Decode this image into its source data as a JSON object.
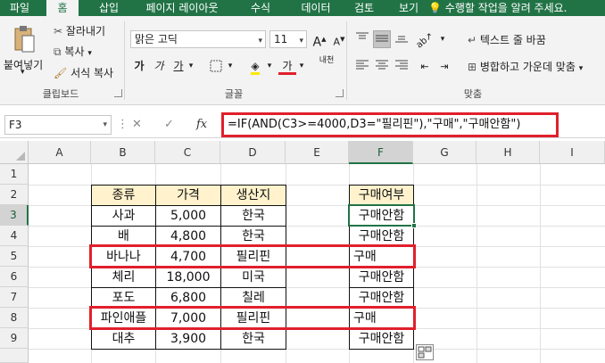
{
  "ribbon_tabs": [
    "파일",
    "홈",
    "삽입",
    "페이지 레이아웃",
    "수식",
    "데이터",
    "검토",
    "보기"
  ],
  "tell_me": "수행할 작업을 알려 주세요.",
  "clipboard": {
    "paste": "붙여넣기",
    "cut": "잘라내기",
    "copy": "복사",
    "format_painter": "서식 복사",
    "label": "클립보드"
  },
  "font": {
    "name": "맑은 고딕",
    "size": "11",
    "bold": "가",
    "italic": "가",
    "underline": "가",
    "font_color": "가",
    "phonetic": "내천",
    "label": "글꼴"
  },
  "alignment": {
    "wrap_text": "텍스트 줄 바꿈",
    "merge_center": "병합하고 가운데 맞춤",
    "label": "맞춤"
  },
  "name_box": "F3",
  "formula": "=IF(AND(C3>=4000,D3=\"필리핀\"),\"구매\",\"구매안함\")",
  "columns": [
    "A",
    "B",
    "C",
    "D",
    "E",
    "F",
    "G",
    "H",
    "I"
  ],
  "rows": [
    "1",
    "2",
    "3",
    "4",
    "5",
    "6",
    "7",
    "8",
    "9"
  ],
  "table": {
    "headers": [
      "종류",
      "가격",
      "생산지"
    ],
    "rows": [
      [
        "사과",
        "5,000",
        "한국"
      ],
      [
        "배",
        "4,800",
        "한국"
      ],
      [
        "바나나",
        "4,700",
        "필리핀"
      ],
      [
        "체리",
        "18,000",
        "미국"
      ],
      [
        "포도",
        "6,800",
        "칠레"
      ],
      [
        "파인애플",
        "7,000",
        "필리핀"
      ],
      [
        "대추",
        "3,900",
        "한국"
      ]
    ]
  },
  "result": {
    "header": "구매여부",
    "values": [
      "구매안함",
      "구매안함",
      "구매",
      "구매안함",
      "구매안함",
      "구매",
      "구매안함"
    ]
  },
  "colors": {
    "excel_green": "#217346",
    "highlight_red": "#e0202c",
    "header_fill": "#fff2cc"
  }
}
